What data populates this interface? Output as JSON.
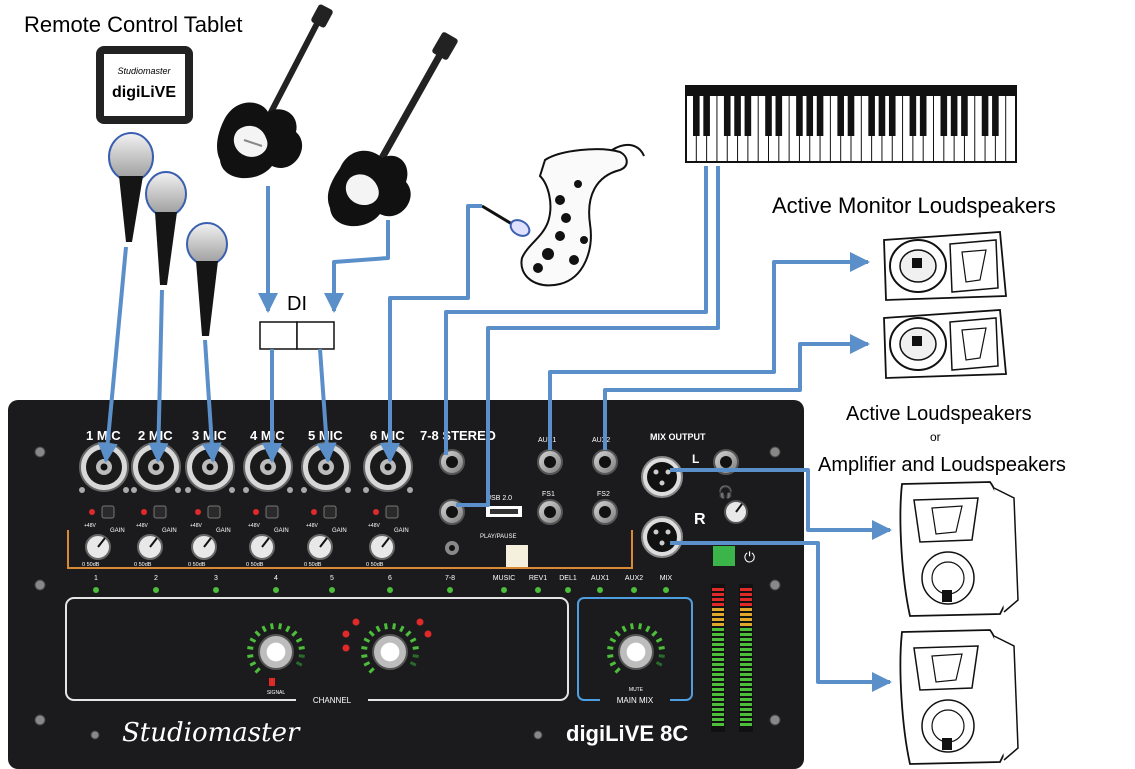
{
  "labels": {
    "title": "Remote Control Tablet",
    "active_monitor": "Active Monitor Loudspeakers",
    "active_speakers": "Active Loudspeakers",
    "or": "or",
    "amp_speakers": "Amplifier and Loudspeakers",
    "di": "DI"
  },
  "tablet": {
    "brand": "Studiomaster",
    "app": "digiLiVE"
  },
  "console": {
    "inputs": [
      "1",
      "2",
      "3",
      "4",
      "5",
      "6"
    ],
    "input_suffix": "MIC",
    "stereo_label": "7-8 STEREO",
    "usb_label": "USB 2.0",
    "play_label": "PLAY/PAUSE",
    "aux_labels": [
      "AUX1",
      "AUX2"
    ],
    "fs_labels": [
      "FS1",
      "FS2"
    ],
    "mix_output": "MIX OUTPUT",
    "gain_label": "GAIN",
    "gain_range": "0   50dB",
    "phantom": "+48V",
    "channel_strip": [
      "1",
      "2",
      "3",
      "4",
      "5",
      "6",
      "7-8",
      "MUSIC",
      "REV1",
      "DEL1",
      "AUX1",
      "AUX2",
      "MIX"
    ],
    "channel_section": "CHANNEL",
    "main_mix_section": "MAIN MIX",
    "signal": "SIGNAL",
    "mute": "MUTE",
    "brand": "Studiomaster",
    "model": "digiLiVE 8C"
  },
  "colors": {
    "cable": "#5b8fc9",
    "console": "#1b1b1d",
    "accent_orange": "#d88a34",
    "led_green": "#4cbe3a",
    "led_red": "#e02a2a",
    "power_green": "#3bb54a",
    "main_mix_box": "#4f9ee0"
  }
}
